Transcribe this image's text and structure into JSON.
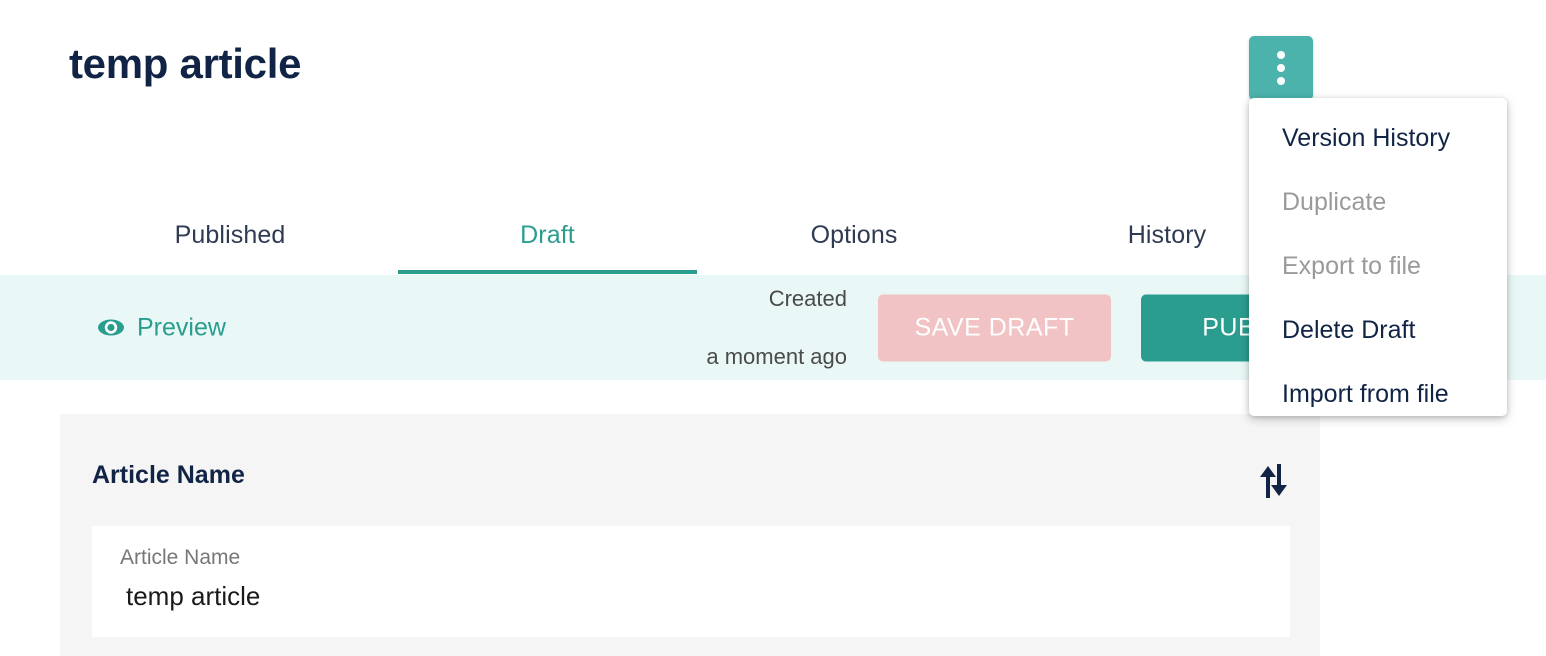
{
  "page": {
    "title": "temp article"
  },
  "kebab": {
    "icon": "kebab-menu-icon"
  },
  "tabs": [
    {
      "label": "Published",
      "active": false
    },
    {
      "label": "Draft",
      "active": true
    },
    {
      "label": "Options",
      "active": false
    },
    {
      "label": "History",
      "active": false
    }
  ],
  "toolbar": {
    "preview_label": "Preview",
    "preview_icon": "eye-icon",
    "created_label": "Created",
    "created_value": "a moment ago",
    "save_draft_label": "SAVE DRAFT",
    "publish_label": "PUBLISH"
  },
  "card": {
    "heading": "Article Name",
    "sort_icon": "sort-up-down-icon",
    "field": {
      "label": "Article Name",
      "value": "temp article",
      "placeholder": "Article Name"
    }
  },
  "menu": {
    "items": [
      {
        "label": "Version History",
        "disabled": false
      },
      {
        "label": "Duplicate",
        "disabled": true
      },
      {
        "label": "Export to file",
        "disabled": true
      },
      {
        "label": "Delete Draft",
        "disabled": false
      },
      {
        "label": "Import from file",
        "disabled": false
      }
    ]
  },
  "colors": {
    "accent_teal": "#2a9d8f",
    "button_teal": "#4cb3ac",
    "toolbar_bg": "#e9f8f6",
    "navy_text": "#112446",
    "pink_button": "#f1c3c4",
    "card_bg": "#f5f5f5",
    "disabled_text": "#9a9a9a"
  }
}
